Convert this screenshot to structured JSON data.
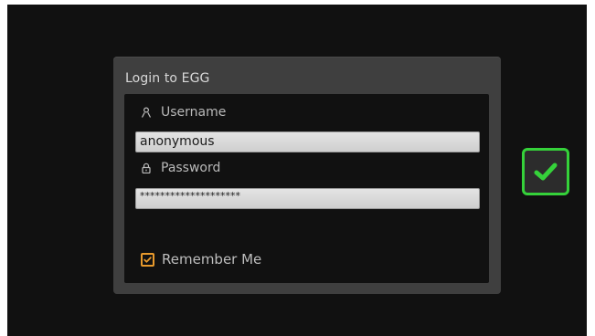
{
  "dialog": {
    "title": "Login to EGG"
  },
  "username": {
    "label": "Username",
    "value": "anonymous",
    "icon": "user-icon"
  },
  "password": {
    "label": "Password",
    "value": "********************",
    "icon": "lock-icon"
  },
  "remember": {
    "label": "Remember Me",
    "checked": true,
    "color": "#e89a2c"
  },
  "confirm": {
    "icon": "checkmark-icon",
    "color": "#35d23a"
  }
}
